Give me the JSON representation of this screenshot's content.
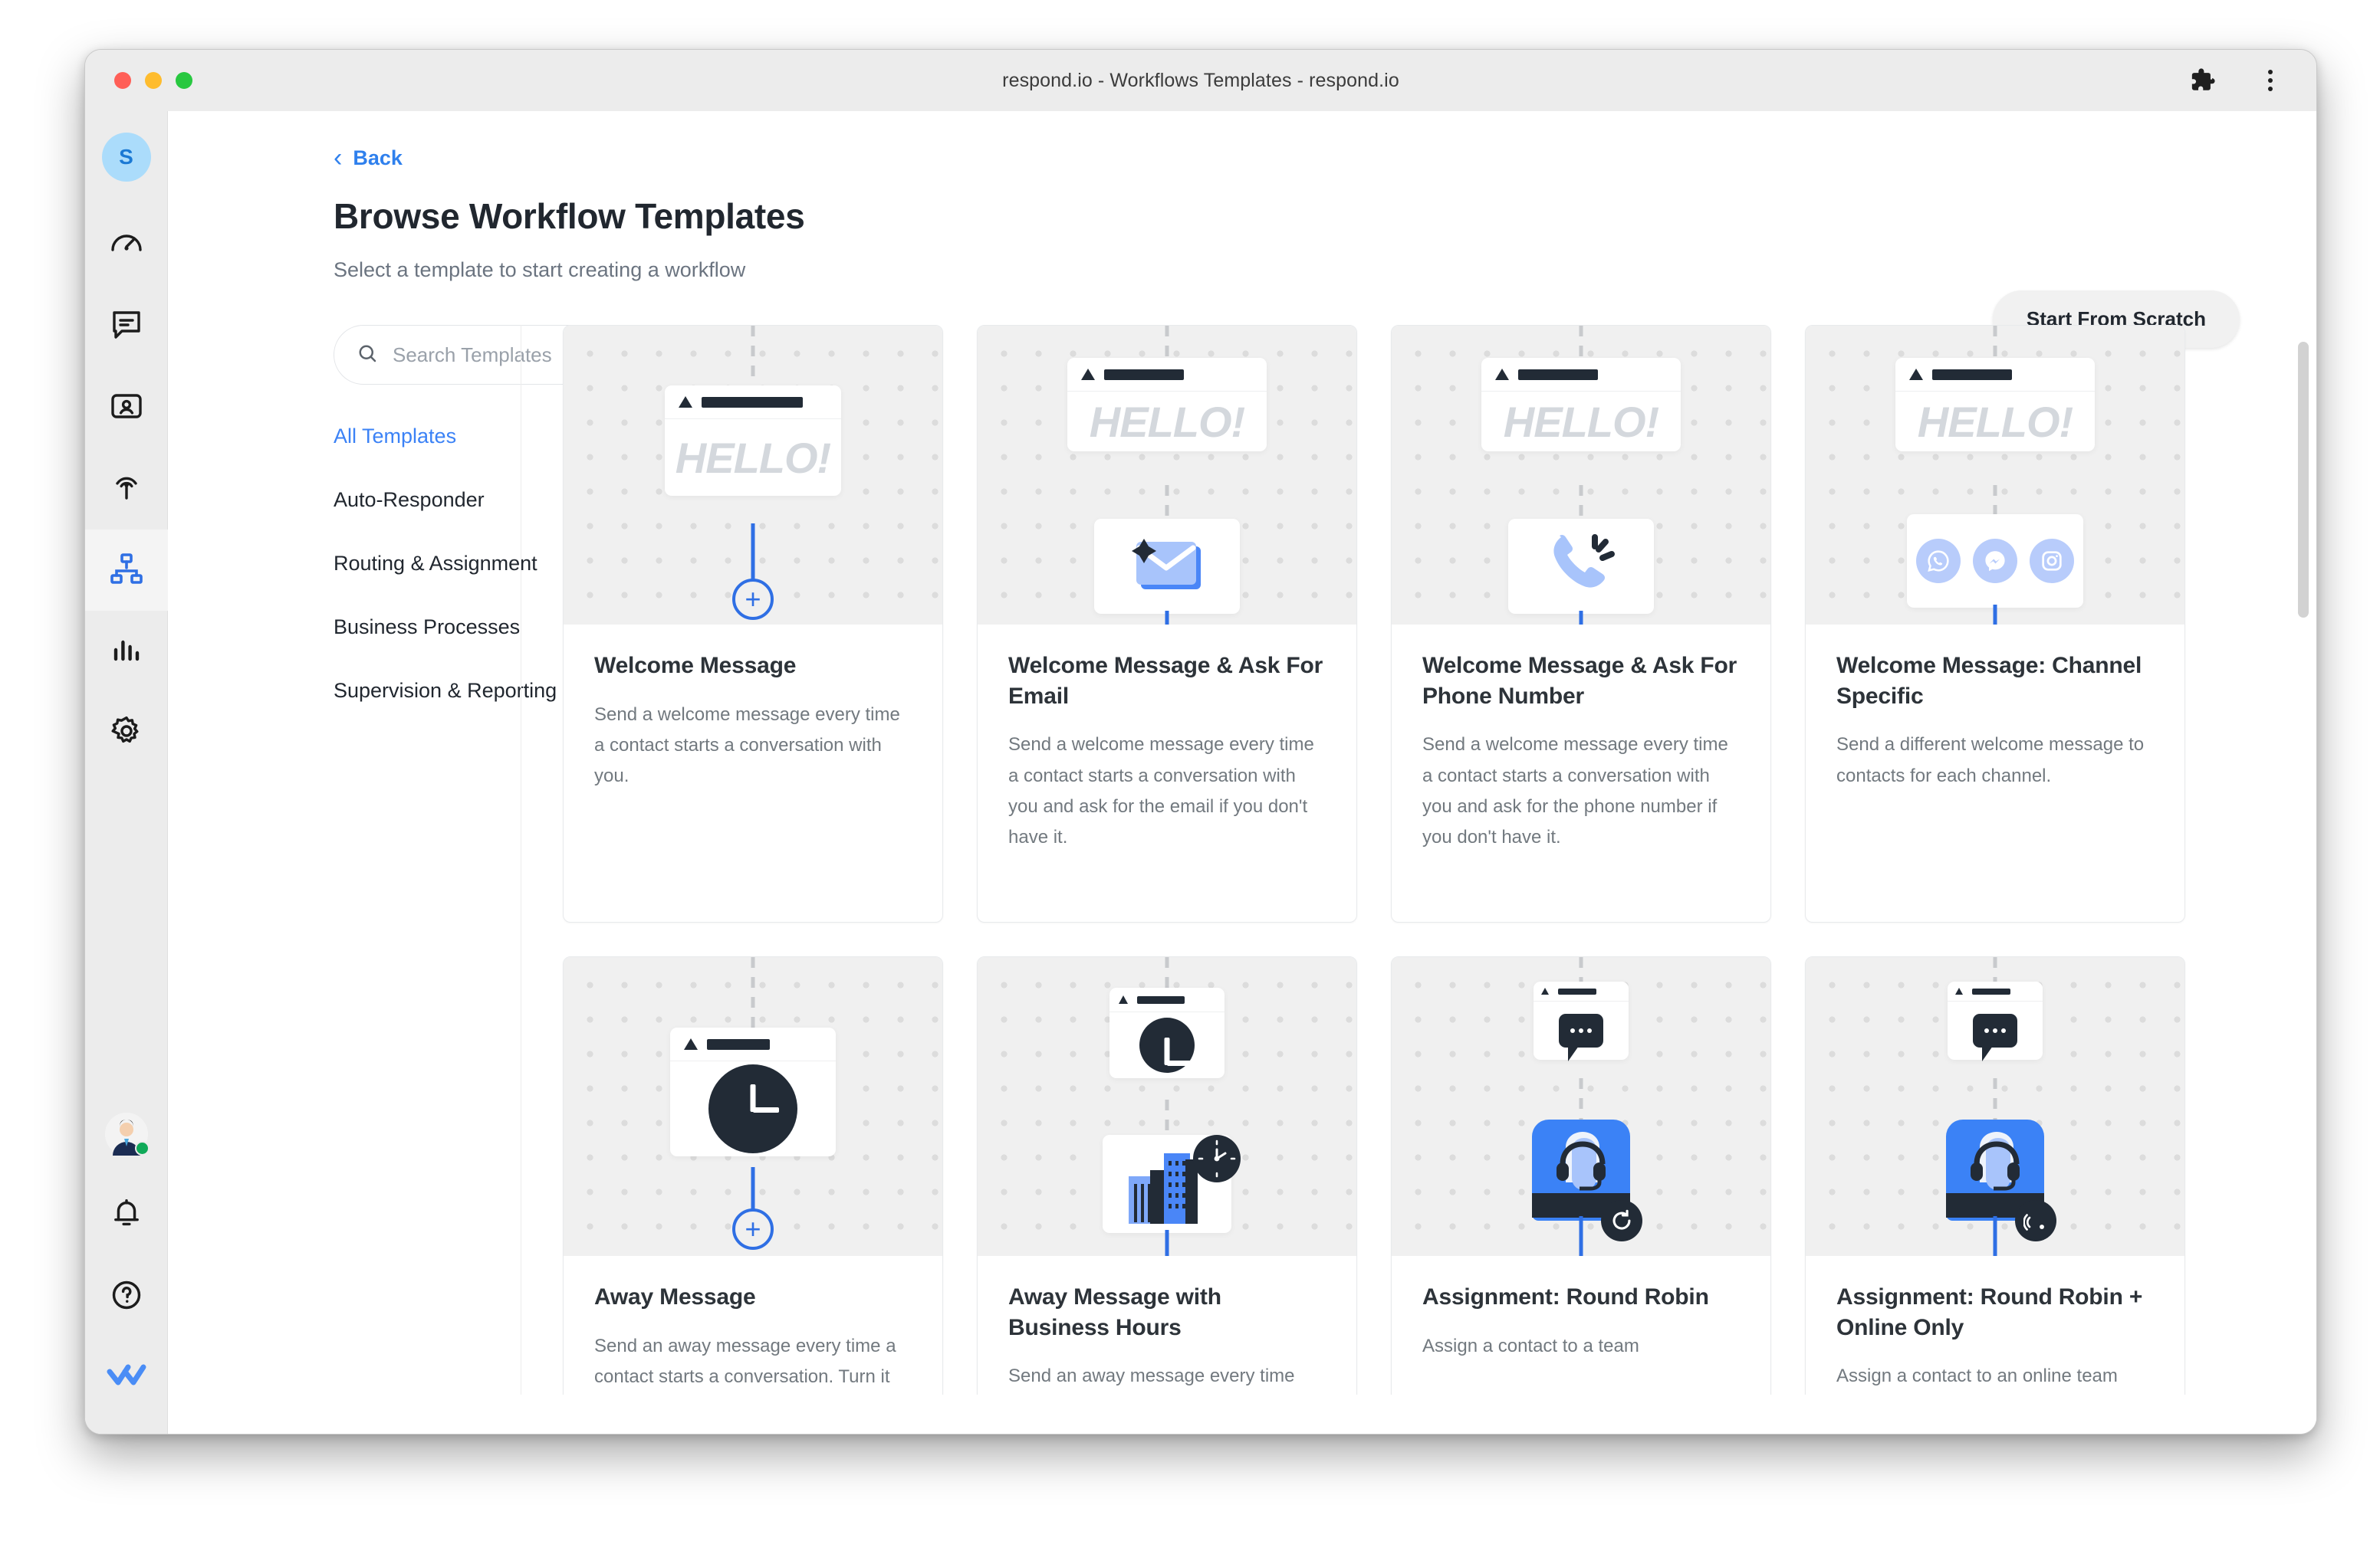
{
  "window": {
    "title": "respond.io - Workflows Templates - respond.io",
    "extensions_icon": "puzzle-icon",
    "menu_icon": "kebab-menu-icon"
  },
  "sidebar": {
    "workspace_initial": "S",
    "items": [
      {
        "name": "dashboard",
        "icon": "speedometer-icon"
      },
      {
        "name": "messages",
        "icon": "chat-bubble-icon"
      },
      {
        "name": "contacts",
        "icon": "contact-card-icon"
      },
      {
        "name": "broadcasts",
        "icon": "broadcast-icon"
      },
      {
        "name": "workflows",
        "icon": "workflow-nodes-icon",
        "active": true
      },
      {
        "name": "reports",
        "icon": "bar-chart-icon"
      },
      {
        "name": "settings",
        "icon": "gear-icon"
      }
    ],
    "bottom_items": [
      {
        "name": "user-avatar",
        "icon": "user-photo-icon",
        "status": "online"
      },
      {
        "name": "notifications",
        "icon": "bell-icon"
      },
      {
        "name": "help",
        "icon": "question-circle-icon"
      },
      {
        "name": "respondio-logo",
        "icon": "double-check-icon"
      }
    ]
  },
  "header": {
    "back_label": "Back",
    "back_icon": "chevron-left-icon",
    "title": "Browse Workflow Templates",
    "subtitle": "Select a template to start creating a workflow",
    "primary_action": "Start From Scratch"
  },
  "filters": {
    "search_placeholder": "Search Templates",
    "search_value": "",
    "search_icon": "search-icon",
    "categories": [
      {
        "label": "All Templates",
        "active": true
      },
      {
        "label": "Auto-Responder",
        "active": false
      },
      {
        "label": "Routing & Assignment",
        "active": false
      },
      {
        "label": "Business Processes",
        "active": false
      },
      {
        "label": "Supervision & Reporting",
        "active": false
      }
    ]
  },
  "templates": [
    {
      "title": "Welcome Message",
      "description": "Send a welcome message every time a contact starts a conversation with you.",
      "preview": "hello-plus"
    },
    {
      "title": "Welcome Message & Ask For Email",
      "description": "Send a welcome message every time a contact starts a conversation with you and ask for the email if you don't have it.",
      "preview": "hello-email"
    },
    {
      "title": "Welcome Message & Ask For Phone Number",
      "description": "Send a welcome message every time a contact starts a conversation with you and ask for the phone number if you don't have it.",
      "preview": "hello-phone"
    },
    {
      "title": "Welcome Message: Channel Specific",
      "description": "Send a different welcome message to contacts for each channel.",
      "preview": "hello-channels",
      "channels": [
        "whatsapp",
        "messenger",
        "instagram"
      ]
    },
    {
      "title": "Away Message",
      "description": "Send an away message every time a contact starts a conversation. Turn it on and off by toggling the",
      "preview": "clock-plus"
    },
    {
      "title": "Away Message with Business Hours",
      "description": "Send an away message every time",
      "preview": "clock-building"
    },
    {
      "title": "Assignment: Round Robin",
      "description": "Assign a contact to a team",
      "preview": "bubble-agent-roundrobin"
    },
    {
      "title": "Assignment: Round Robin + Online Only",
      "description": "Assign a contact to an online team",
      "preview": "bubble-agent-online"
    }
  ],
  "preview_text": {
    "hello": "HELLO!"
  },
  "colors": {
    "accent_blue": "#2f6fe4",
    "link_blue": "#3b82f6",
    "node_dark": "#222b36",
    "channel_blue": "#b8ccfb",
    "online_green": "#0fa958"
  }
}
